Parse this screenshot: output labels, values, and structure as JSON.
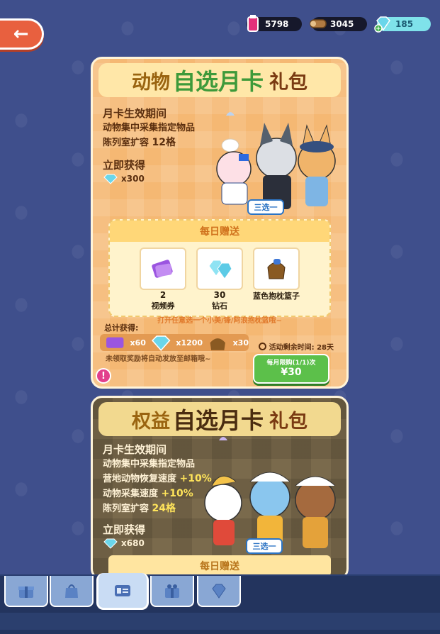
{
  "resources": {
    "potion": "5798",
    "wood": "3045",
    "diamond": "185"
  },
  "card1": {
    "title_a": "动物",
    "title_b": "自选月卡",
    "title_c": "礼包",
    "effect_head": "月卡生效期间",
    "effect_1": "动物集中采集指定物品",
    "effect_2": "陈列室扩容",
    "effect_2_value": "12格",
    "instant_head": "立即获得",
    "instant_qty": "x300",
    "choose_label": "三选一",
    "daily_title": "每日赠送",
    "items": [
      {
        "count": "2",
        "name": "视频券"
      },
      {
        "count": "30",
        "name": "钻石"
      },
      {
        "count": "",
        "name": "蓝色抱枕篮子"
      }
    ],
    "daily_note": "打开任意选一个小美/锋/阿浪抱枕篮哦~",
    "total_label": "总计获得:",
    "totals": [
      "x60",
      "x1200",
      "x30"
    ],
    "unclaimed": "未领取奖励将自动发放至邮箱哦~",
    "timer": "活动剩余时间: 28天",
    "buy_limit": "每月限购(1/1)次",
    "price": "¥30"
  },
  "card2": {
    "title_a": "权益",
    "title_b": "自选月卡",
    "title_c": "礼包",
    "effect_head": "月卡生效期间",
    "effect_1": "动物集中采集指定物品",
    "effect_2": "营地动物恢复速度",
    "effect_2_value": "+10%",
    "effect_3": "动物采集速度",
    "effect_3_value": "+10%",
    "effect_4": "陈列室扩容",
    "effect_4_value": "24格",
    "instant_head": "立即获得",
    "instant_qty": "x680",
    "choose_label": "三选一",
    "daily_title": "每日赠送"
  },
  "colors": {
    "background": "#3f4f8c",
    "card1": "#f5b873",
    "card2": "#7a6a4c",
    "buy_button": "#5cc04a",
    "accent_green": "#3e9a3a"
  }
}
